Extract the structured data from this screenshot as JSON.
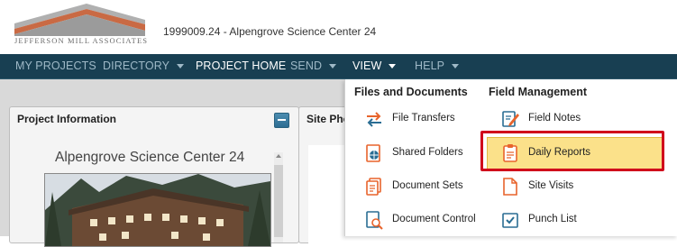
{
  "header": {
    "logo_text": "JEFFERSON MILL ASSOCIATES",
    "project_title": "1999009.24 - Alpengrove Science Center 24"
  },
  "nav": {
    "items": [
      {
        "label": "MY PROJECTS",
        "dropdown": false
      },
      {
        "label": "DIRECTORY",
        "dropdown": true
      },
      {
        "label": "PROJECT HOME",
        "dropdown": false
      },
      {
        "label": "SEND",
        "dropdown": true
      },
      {
        "label": "VIEW",
        "dropdown": true
      },
      {
        "label": "HELP",
        "dropdown": true
      }
    ]
  },
  "panels": {
    "info_title": "Project Information",
    "photos_title": "Site Pho",
    "project_name": "Alpengrove Science Center 24"
  },
  "dropdown": {
    "files_heading": "Files and Documents",
    "field_heading": "Field Management",
    "files_items": [
      {
        "label": "File Transfers",
        "icon": "file-transfers-icon"
      },
      {
        "label": "Shared Folders",
        "icon": "shared-folders-icon"
      },
      {
        "label": "Document Sets",
        "icon": "document-sets-icon"
      },
      {
        "label": "Document Control",
        "icon": "document-control-icon"
      }
    ],
    "field_items": [
      {
        "label": "Field Notes",
        "icon": "field-notes-icon"
      },
      {
        "label": "Daily Reports",
        "icon": "daily-reports-icon",
        "highlighted": true
      },
      {
        "label": "Site Visits",
        "icon": "site-visits-icon"
      },
      {
        "label": "Punch List",
        "icon": "punch-list-icon"
      }
    ]
  },
  "colors": {
    "nav_bg": "#183f52",
    "accent_orange": "#e8642c",
    "highlight_bg": "#fbe18a",
    "callout_red": "#d0021b",
    "icon_blue": "#2a6d93"
  }
}
